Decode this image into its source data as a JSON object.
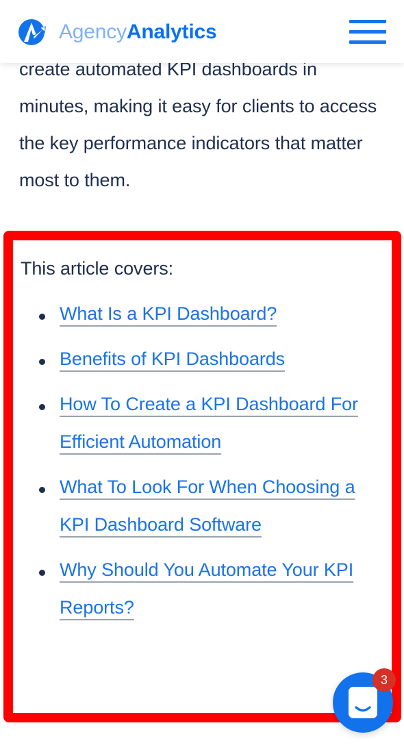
{
  "header": {
    "brand_light": "Agency",
    "brand_bold": "Analytics",
    "logo_icon": "agencyanalytics-logo-icon",
    "menu_icon": "hamburger-menu-icon",
    "brand_blue": "#0A72F0",
    "brand_light_blue": "#7FB2F7"
  },
  "article": {
    "intro_paragraph": "create automated KPI dashboards in minutes, making it easy for clients to access the key performance indicators that matter most to them."
  },
  "covers": {
    "heading": "This article covers:",
    "highlight_color": "#FF0000",
    "link_color": "#1A73E8",
    "links": [
      {
        "label": "What Is a KPI Dashboard?"
      },
      {
        "label": "Benefits of KPI Dashboards"
      },
      {
        "label": "How To Create a KPI Dashboard For Efficient Automation"
      },
      {
        "label": "What To Look For When Choosing a KPI Dashboard Software"
      },
      {
        "label": "Why Should You Automate Your KPI Reports?"
      }
    ]
  },
  "chat": {
    "launcher_icon": "intercom-chat-icon",
    "unread_count": "3",
    "badge_color": "#D93025",
    "bubble_color": "#1272EB"
  }
}
